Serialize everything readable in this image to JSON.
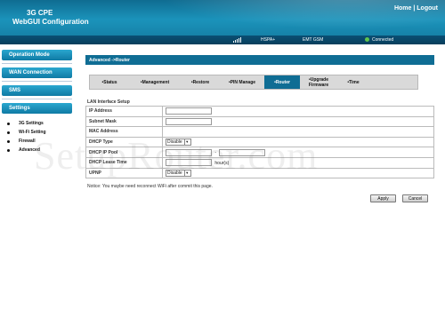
{
  "header": {
    "title_line1": "3G CPE",
    "title_line2": "WebGUI Configuration",
    "home_link": "Home",
    "separator": "|",
    "logout_link": "Logout"
  },
  "status_bar": {
    "signal_icon": "signal-bars-icon",
    "network_type": "HSPA+",
    "operator": "EMT GSM",
    "connection_icon": "globe-icon",
    "connection_status": "Connected"
  },
  "sidebar": {
    "menus": [
      "Operation Mode",
      "WAN Connection",
      "SMS",
      "Settings"
    ],
    "settings_items": [
      "3G Settings",
      "Wi-Fi Setting",
      "Firewall",
      "Advanced"
    ]
  },
  "main": {
    "breadcrumb": "Advanced ->Router",
    "tabs": [
      {
        "label": "•Status"
      },
      {
        "label": "•Management"
      },
      {
        "label": "•Restore"
      },
      {
        "label": "•PIN Manage"
      },
      {
        "label": "•Router"
      },
      {
        "label": "•Upgrade Firmware"
      },
      {
        "label": "•Time"
      }
    ],
    "active_tab": "•Router",
    "section_title": "LAN Interface Setup",
    "fields": {
      "ip_address": {
        "label": "IP Address",
        "value": ""
      },
      "subnet_mask": {
        "label": "Subnet Mask",
        "value": ""
      },
      "mac_address": {
        "label": "MAC Address",
        "value": ""
      },
      "dhcp_type": {
        "label": "DHCP Type",
        "value": "Disable"
      },
      "dhcp_ip_pool": {
        "label": "DHCP IP Pool",
        "start": "",
        "separator": "-",
        "end": ""
      },
      "dhcp_lease_time": {
        "label": "DHCP Lease Time",
        "value": "",
        "unit": "hour(s)"
      },
      "upnp": {
        "label": "UPNP",
        "value": "Disable"
      }
    },
    "notice": "Notice: You maybe need reconnect WiFi after commit this page.",
    "apply_label": "Apply",
    "cancel_label": "Cancel"
  },
  "watermark": "SetupRouter.com"
}
